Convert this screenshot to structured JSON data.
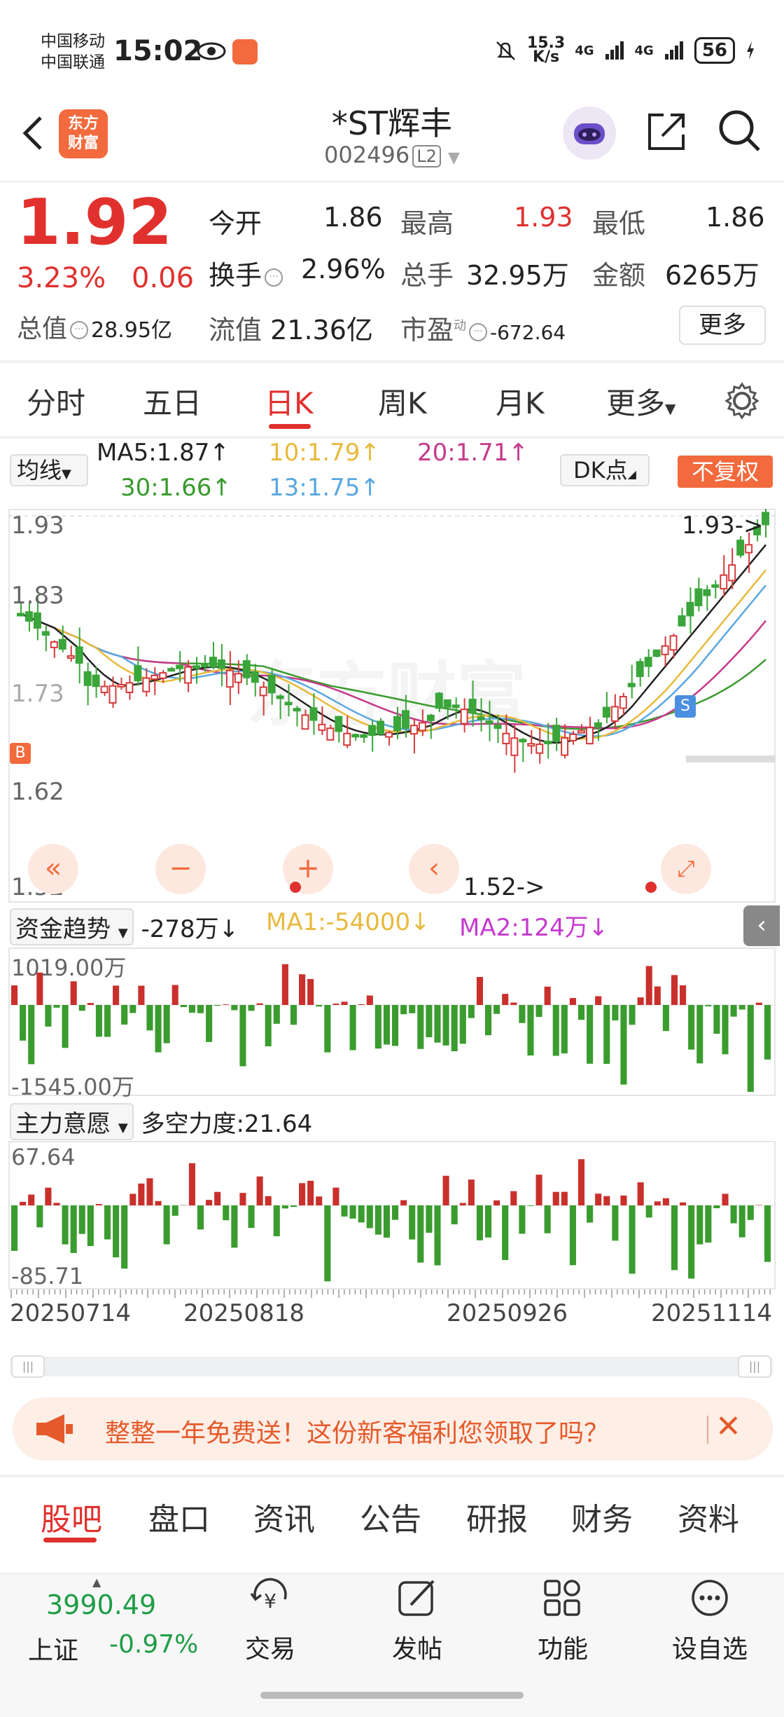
{
  "status_bar": {
    "carrier1": "中国移动",
    "carrier2": "中国联通",
    "time": "15:02",
    "net_speed_top": "15.3",
    "net_speed_bottom": "K/s",
    "sig1": "4G",
    "sig2": "4G",
    "battery": "56"
  },
  "header": {
    "logo_line1": "东方",
    "logo_line2": "财富",
    "title": "*ST辉丰",
    "code": "002496",
    "level": "L2"
  },
  "quote": {
    "price": "1.92",
    "change_pct": "3.23%",
    "change": "0.06",
    "open_label": "今开",
    "open": "1.86",
    "high_label": "最高",
    "high": "1.93",
    "low_label": "最低",
    "low": "1.86",
    "turnover_label": "换手",
    "turnover": "2.96%",
    "volume_label": "总手",
    "volume": "32.95万",
    "amount_label": "金额",
    "amount": "6265万",
    "mktcap_label": "总值",
    "mktcap": "28.95亿",
    "float_label": "流值",
    "float": "21.36亿",
    "pe_label": "市盈",
    "pe_sup": "动",
    "pe": "-672.64",
    "more_label": "更多"
  },
  "period_tabs": [
    "分时",
    "五日",
    "日K",
    "周K",
    "月K",
    "更多"
  ],
  "legend": {
    "junxian": "均线",
    "ma5": "MA5:1.87↑",
    "ma10": "10:1.79↑",
    "ma20": "20:1.71↑",
    "ma30": "30:1.66↑",
    "ma13": "13:1.75↑",
    "dk": "DK点",
    "fuquan": "不复权",
    "colors": {
      "ma5": "#222222",
      "ma10": "#e8b93c",
      "ma20": "#c63a8a",
      "ma30": "#3a9a2e",
      "ma13": "#5aa7e0"
    }
  },
  "kline": {
    "y_labels": [
      "1.93",
      "1.83",
      "1.73",
      "1.62",
      "1.52"
    ],
    "high_marker": "1.93->",
    "low_marker": "1.52->",
    "b_marker": "B",
    "s_marker": "S",
    "watermark": "东方财富"
  },
  "capital_trend": {
    "selector": "资金趋势",
    "value": "-278万↓",
    "ma1": "MA1:-54000↓",
    "ma2": "MA2:124万↓",
    "y_top": "1019.00万",
    "y_bottom": "-1545.00万"
  },
  "main_intent": {
    "selector": "主力意愿",
    "value": "多空力度:21.64",
    "y_top": "67.64",
    "y_bottom": "-85.71"
  },
  "dates": [
    "20250714",
    "20250818",
    "20250926",
    "20251114"
  ],
  "banner": {
    "text": "整整一年免费送！这份新客福利您领取了吗？"
  },
  "bottom_tabs": [
    "股吧",
    "盘口",
    "资讯",
    "公告",
    "研报",
    "财务",
    "资料"
  ],
  "footer": {
    "index_value": "3990.49",
    "index_name": "上证",
    "index_change": "-0.97%",
    "nav": [
      "交易",
      "发帖",
      "功能",
      "设自选"
    ]
  }
}
